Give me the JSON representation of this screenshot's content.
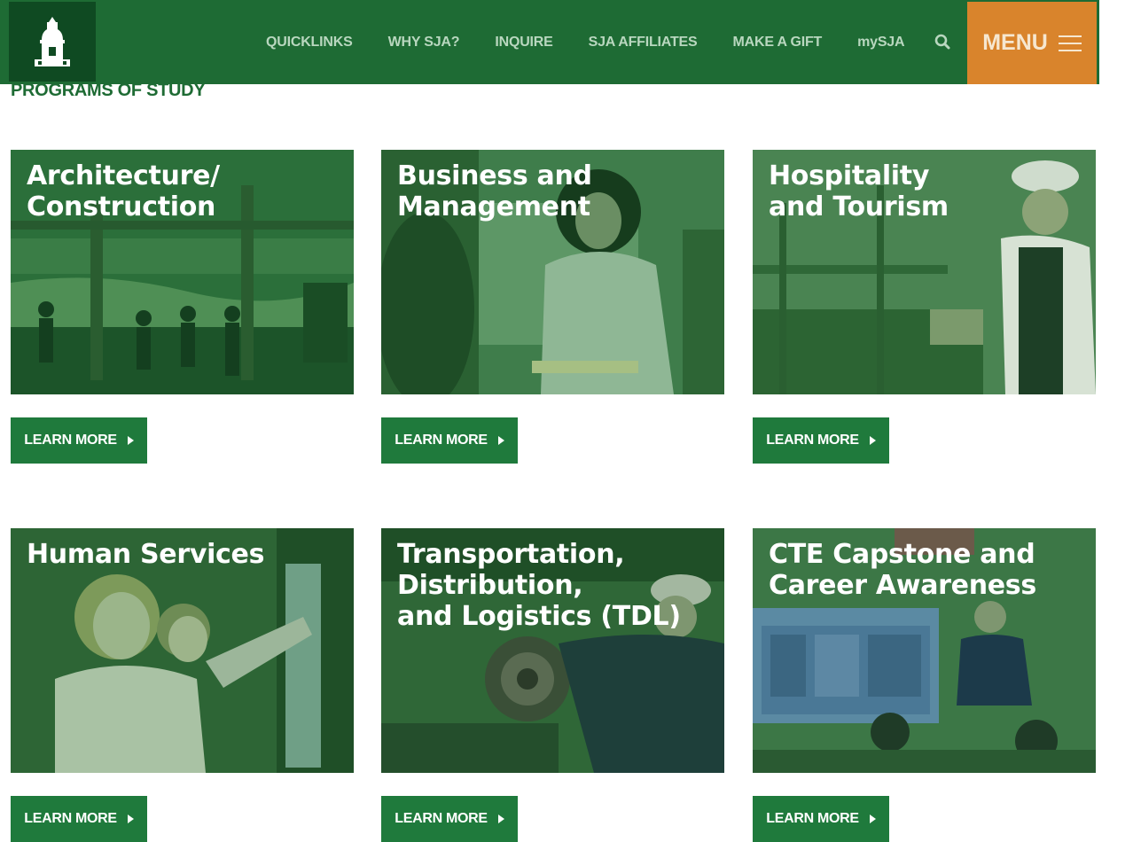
{
  "header": {
    "nav": [
      "QUICKLINKS",
      "WHY SJA?",
      "INQUIRE",
      "SJA AFFILIATES",
      "MAKE A GIFT",
      "mySJA"
    ],
    "menu_label": "MENU"
  },
  "section_title": "PROGRAMS OF STUDY",
  "cards": [
    {
      "title": "Architecture/\nConstruction",
      "button": "LEARN MORE"
    },
    {
      "title": "Business and\nManagement",
      "button": "LEARN MORE"
    },
    {
      "title": "Hospitality\nand Tourism",
      "button": "LEARN MORE"
    },
    {
      "title": "Human Services",
      "button": "LEARN MORE"
    },
    {
      "title": "Transportation,\nDistribution,\nand Logistics (TDL)",
      "button": "LEARN MORE"
    },
    {
      "title": "CTE Capstone and\nCareer Awareness",
      "button": "LEARN MORE"
    }
  ],
  "colors": {
    "brand_green": "#1e6b34",
    "button_green": "#1f7a3c",
    "menu_orange": "#d9842c"
  },
  "icons": [
    "building-tower-logo",
    "search-icon",
    "hamburger-icon",
    "chevron-right-icon"
  ]
}
